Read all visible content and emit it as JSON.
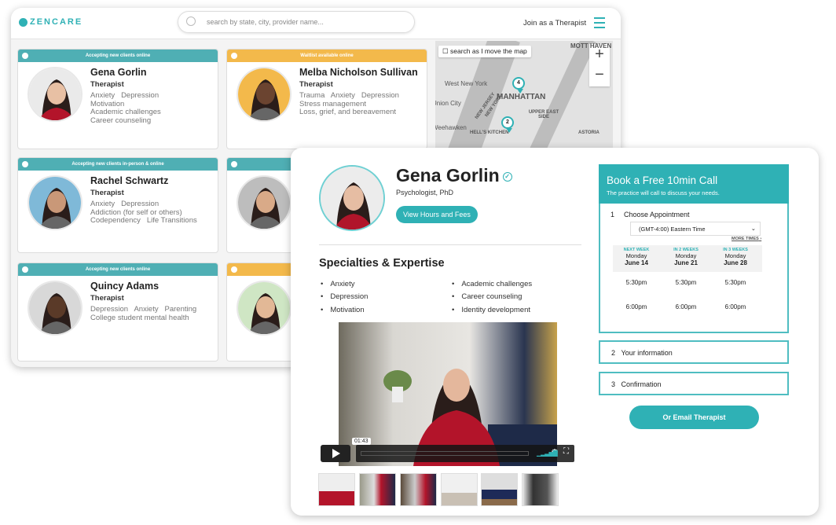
{
  "back": {
    "logo": "ZENCARE",
    "search_placeholder": "search by state, city, provider name...",
    "join": "Join as a Therapist",
    "cards": [
      {
        "status": "Accepting new clients online",
        "status_color": "#4fafb4",
        "name": "Gena Gorlin",
        "role": "Therapist",
        "tags": [
          "Anxiety   Depression",
          "Motivation",
          "Academic challenges",
          "Career counseling"
        ]
      },
      {
        "status": "Waitlist available online",
        "status_color": "#f3b94b",
        "name": "Melba Nicholson Sullivan",
        "role": "Therapist",
        "tags": [
          "Trauma   Anxiety   Depression",
          "Stress management",
          "Loss, grief, and bereavement"
        ]
      },
      {
        "status": "Accepting new clients in-person & online",
        "status_color": "#4fafb4",
        "name": "Rachel Schwartz",
        "role": "Therapist",
        "tags": [
          "Anxiety   Depression",
          "Addiction (for self or others)",
          "Codependency   Life Transitions"
        ]
      },
      {
        "status": "",
        "status_color": "#4fafb4",
        "name": "",
        "role": "",
        "tags": []
      },
      {
        "status": "Accepting new clients online",
        "status_color": "#4fafb4",
        "name": "Quincy Adams",
        "role": "Therapist",
        "tags": [
          "Depression   Anxiety   Parenting",
          "College student mental health"
        ]
      },
      {
        "status": "",
        "status_color": "#f3b94b",
        "name": "",
        "role": "",
        "tags": []
      }
    ],
    "map": {
      "checkbox_label": "search as I move the map",
      "labels": [
        "MOTT HAVEN",
        "West New York",
        "Union City",
        "MANHATTAN",
        "NEW JERSEY",
        "NEW YORK",
        "UPPER EAST SIDE",
        "Weehawken",
        "HELL'S KITCHEN",
        "ASTORIA"
      ],
      "pins": [
        "4",
        "2"
      ]
    }
  },
  "profile": {
    "name": "Gena Gorlin",
    "title": "Psychologist, PhD",
    "hours_button": "View Hours and Fees",
    "specialties_heading": "Specialties & Expertise",
    "specialties": [
      "Anxiety",
      "Depression",
      "Motivation",
      "Academic challenges",
      "Career counseling",
      "Identity development"
    ],
    "video_time": "01:43",
    "thumbnail_count": 6
  },
  "booking": {
    "title": "Book a Free 10min Call",
    "subtitle": "The practice will call to discuss your needs.",
    "step1": {
      "num": "1",
      "label": "Choose Appointment"
    },
    "timezone": "(GMT-4:00) Eastern Time",
    "more_times": "MORE TIMES",
    "columns": [
      {
        "when": "NEXT WEEK",
        "day": "Monday",
        "date": "June 14",
        "times": [
          "5:30pm",
          "6:00pm"
        ]
      },
      {
        "when": "IN 2 WEEKS",
        "day": "Monday",
        "date": "June 21",
        "times": [
          "5:30pm",
          "6:00pm"
        ]
      },
      {
        "when": "IN 3 WEEKS",
        "day": "Monday",
        "date": "June 28",
        "times": [
          "5:30pm",
          "6:00pm"
        ]
      }
    ],
    "step2": {
      "num": "2",
      "label": "Your information"
    },
    "step3": {
      "num": "3",
      "label": "Confirmation"
    },
    "email_button": "Or Email Therapist"
  },
  "colors": {
    "accent": "#2fb1b5",
    "waitlist": "#f3b94b"
  }
}
